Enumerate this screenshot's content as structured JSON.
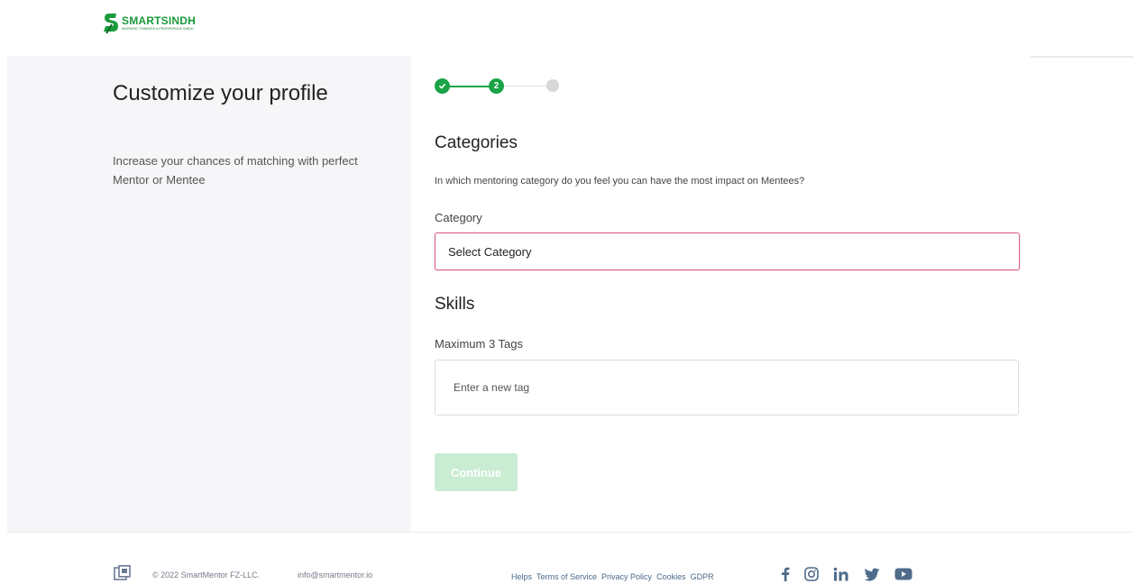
{
  "brand": {
    "name": "SMARTSINDH",
    "tagline": "WORKING TOWARDS A PROSPEROUS SINDH",
    "accent": "#1aa347"
  },
  "intro": {
    "title": "Customize your profile",
    "subtitle": "Increase your chances of matching with perfect Mentor or Mentee"
  },
  "stepper": {
    "current_label": "2"
  },
  "categories": {
    "heading": "Categories",
    "question": "In which mentoring category do you feel you can have the most impact on Mentees?",
    "label": "Category",
    "selected": "Select Category"
  },
  "skills": {
    "heading": "Skills",
    "label": "Maximum 3 Tags",
    "placeholder": "Enter a new tag"
  },
  "actions": {
    "continue_label": "Continue"
  },
  "footer": {
    "copyright": "© 2022 SmartMentor FZ-LLC.",
    "email": "info@smartmentor.io",
    "links": [
      "Helps",
      "Terms of Service",
      "Privacy Policy",
      "Cookies",
      "GDPR"
    ],
    "socials": [
      "facebook-icon",
      "instagram-icon",
      "linkedin-icon",
      "twitter-icon",
      "youtube-icon"
    ]
  }
}
